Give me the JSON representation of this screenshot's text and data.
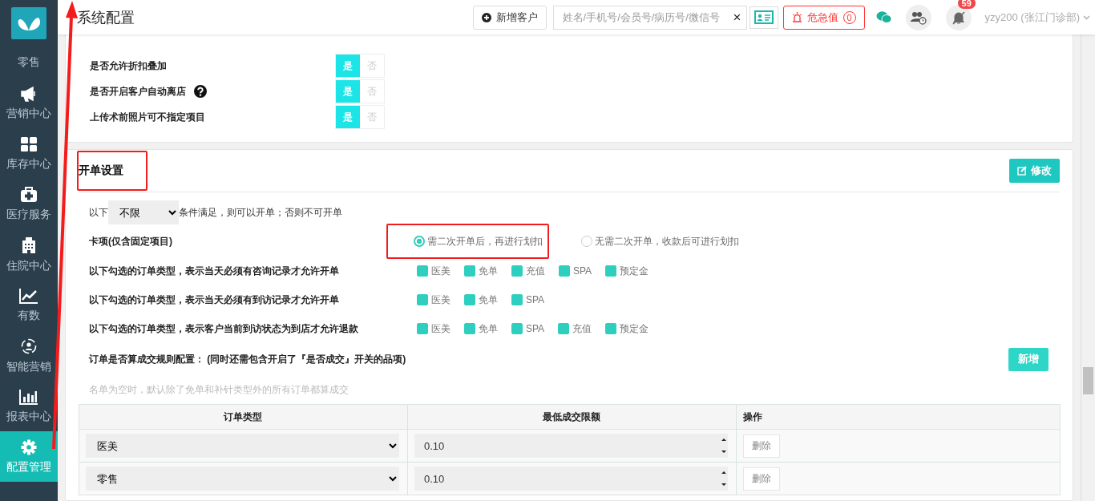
{
  "sidebar": {
    "items": [
      {
        "label": "零售",
        "selected": false
      },
      {
        "label": "营销中心",
        "selected": false
      },
      {
        "label": "库存中心",
        "selected": false
      },
      {
        "label": "医疗服务",
        "selected": false
      },
      {
        "label": "住院中心",
        "selected": false
      },
      {
        "label": "有数",
        "selected": false
      },
      {
        "label": "智能营销",
        "selected": false
      },
      {
        "label": "报表中心",
        "selected": false
      },
      {
        "label": "配置管理",
        "selected": true
      }
    ]
  },
  "header": {
    "title": "系统配置",
    "new_customer_button": "新增客户",
    "search": {
      "placeholder": "姓名/手机号/会员号/病历号/微信号",
      "clear": "×"
    },
    "critical_button": {
      "label": "危急值",
      "count": "0"
    },
    "notification_count": "59",
    "user": "yzy200 (张江门诊部)"
  },
  "toggle_card": {
    "rows": [
      {
        "label": "是否允许折扣叠加",
        "help": false,
        "options": [
          {
            "label": "是",
            "selected": true
          },
          {
            "label": "否",
            "selected": false
          }
        ]
      },
      {
        "label": "是否开启客户自动离店",
        "help": true,
        "options": [
          {
            "label": "是",
            "selected": true
          },
          {
            "label": "否",
            "selected": false
          }
        ]
      },
      {
        "label": "上传术前照片可不指定项目",
        "help": false,
        "options": [
          {
            "label": "是",
            "selected": true
          },
          {
            "label": "否",
            "selected": false
          }
        ]
      }
    ]
  },
  "order_card": {
    "title": "开单设置",
    "highlighted": true,
    "edit_button": "修改",
    "condition": {
      "prefix": "以下",
      "select": "不限",
      "suffix": "条件满足，则可以开单；否则不可开单"
    },
    "card_item": {
      "label": "卡项(仅含固定项目)",
      "options": [
        {
          "label": "需二次开单后，再进行划扣",
          "selected": true,
          "highlighted": true
        },
        {
          "label": "无需二次开单，收款后可进行划扣",
          "selected": false,
          "highlighted": false
        }
      ]
    },
    "check_groups": [
      {
        "label": "以下勾选的订单类型，表示当天必须有咨询记录才允许开单",
        "options": [
          {
            "label": "医美",
            "checked": true
          },
          {
            "label": "免单",
            "checked": true
          },
          {
            "label": "充值",
            "checked": true
          },
          {
            "label": "SPA",
            "checked": true
          },
          {
            "label": "预定金",
            "checked": true
          }
        ]
      },
      {
        "label": "以下勾选的订单类型，表示当天必须有到访记录才允许开单",
        "options": [
          {
            "label": "医美",
            "checked": true
          },
          {
            "label": "免单",
            "checked": true
          },
          {
            "label": "SPA",
            "checked": true
          }
        ]
      },
      {
        "label": "以下勾选的订单类型，表示客户当前到访状态为到店才允许退款",
        "options": [
          {
            "label": "医美",
            "checked": true
          },
          {
            "label": "免单",
            "checked": true
          },
          {
            "label": "SPA",
            "checked": true
          },
          {
            "label": "充值",
            "checked": true
          },
          {
            "label": "预定金",
            "checked": true
          }
        ]
      }
    ],
    "deal_rule": {
      "label": "订单是否算成交规则配置：  (同时还需包含开启了『是否成交』开关的品项)",
      "add_button": "新增",
      "hint": "名单为空时，默认除了免单和补针类型外的所有订单都算成交"
    },
    "table": {
      "columns": [
        "订单类型",
        "最低成交限额",
        "操作"
      ],
      "rows": [
        {
          "order_type": "医美",
          "min_amount": "0.10",
          "delete": "删除"
        },
        {
          "order_type": "零售",
          "min_amount": "0.10",
          "delete": "删除"
        }
      ]
    }
  },
  "annotation_arrow": true
}
